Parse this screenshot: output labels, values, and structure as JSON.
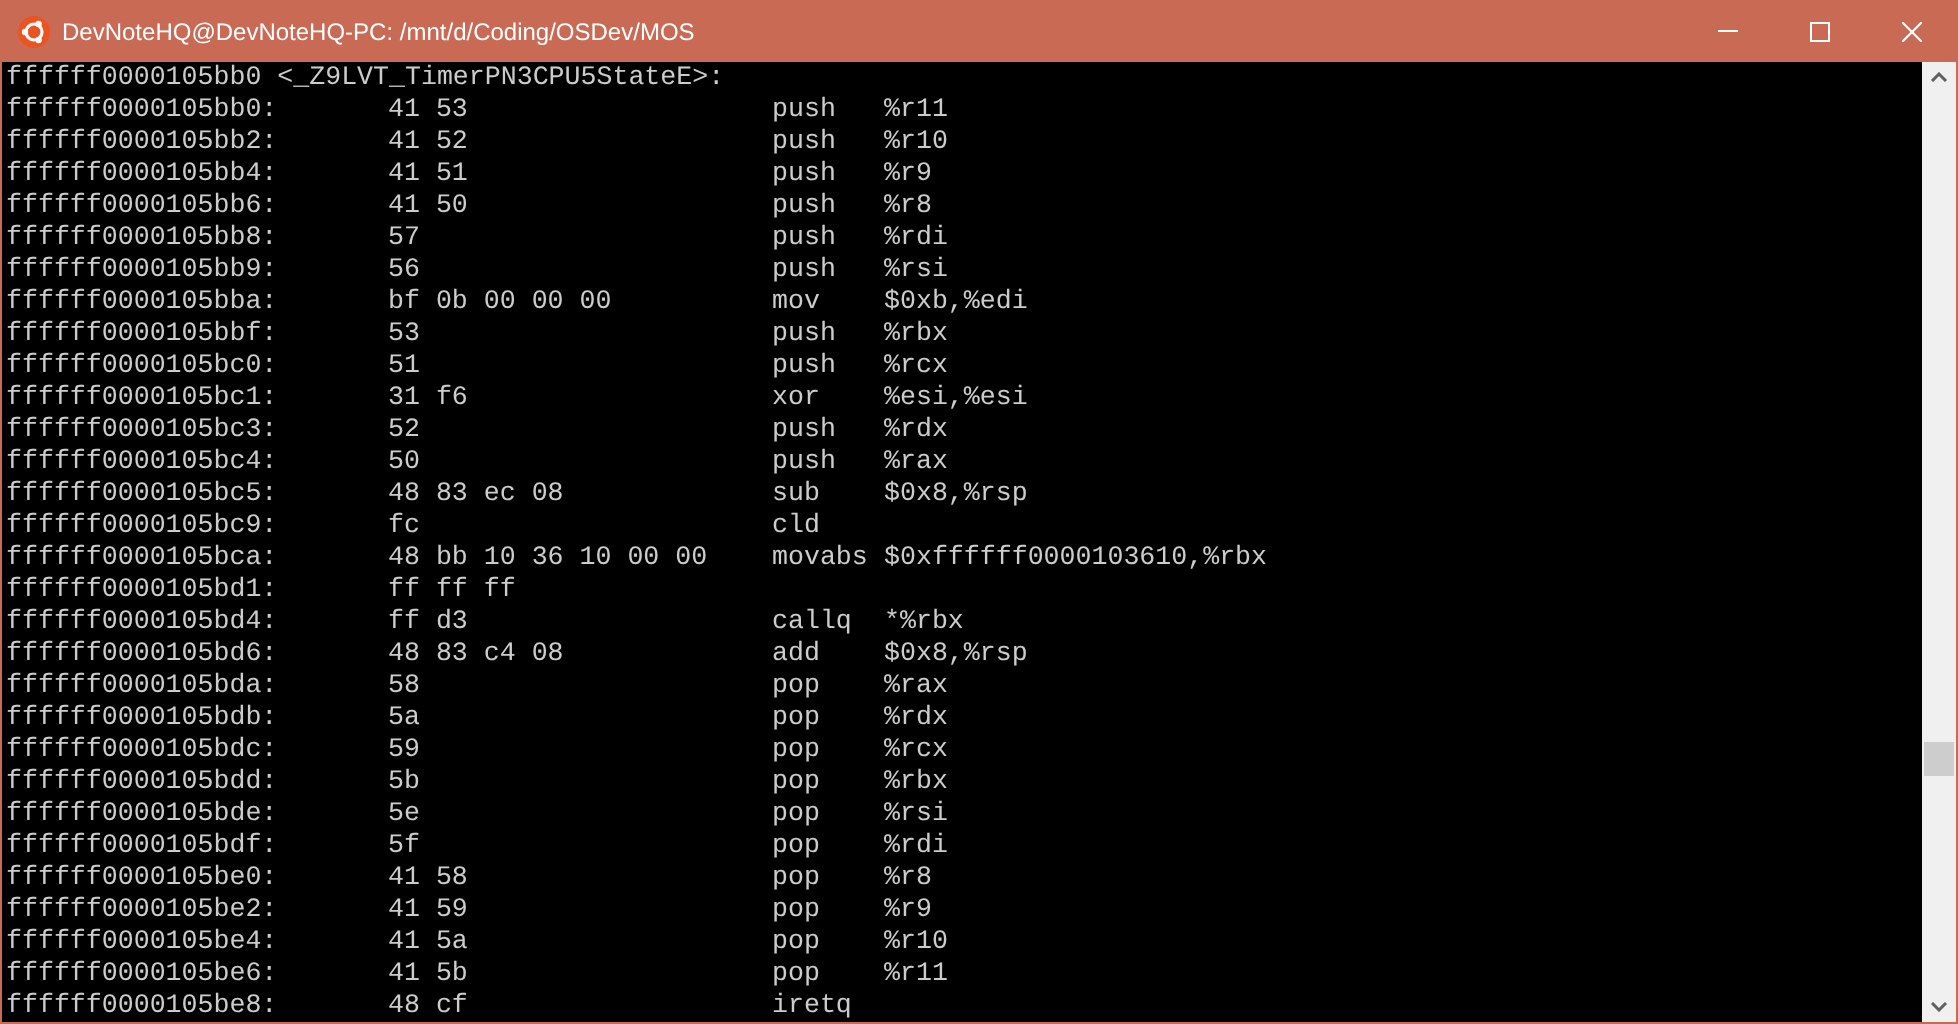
{
  "window": {
    "title": "DevNoteHQ@DevNoteHQ-PC: /mnt/d/Coding/OSDev/MOS"
  },
  "terminal": {
    "header": "ffffff0000105bb0 <_Z9LVT_TimerPN3CPU5StateE>:",
    "lines": [
      {
        "address": "ffffff0000105bb0:",
        "bytes": "41 53",
        "mnemonic": "push",
        "operands": "%r11"
      },
      {
        "address": "ffffff0000105bb2:",
        "bytes": "41 52",
        "mnemonic": "push",
        "operands": "%r10"
      },
      {
        "address": "ffffff0000105bb4:",
        "bytes": "41 51",
        "mnemonic": "push",
        "operands": "%r9"
      },
      {
        "address": "ffffff0000105bb6:",
        "bytes": "41 50",
        "mnemonic": "push",
        "operands": "%r8"
      },
      {
        "address": "ffffff0000105bb8:",
        "bytes": "57",
        "mnemonic": "push",
        "operands": "%rdi"
      },
      {
        "address": "ffffff0000105bb9:",
        "bytes": "56",
        "mnemonic": "push",
        "operands": "%rsi"
      },
      {
        "address": "ffffff0000105bba:",
        "bytes": "bf 0b 00 00 00",
        "mnemonic": "mov",
        "operands": "$0xb,%edi"
      },
      {
        "address": "ffffff0000105bbf:",
        "bytes": "53",
        "mnemonic": "push",
        "operands": "%rbx"
      },
      {
        "address": "ffffff0000105bc0:",
        "bytes": "51",
        "mnemonic": "push",
        "operands": "%rcx"
      },
      {
        "address": "ffffff0000105bc1:",
        "bytes": "31 f6",
        "mnemonic": "xor",
        "operands": "%esi,%esi"
      },
      {
        "address": "ffffff0000105bc3:",
        "bytes": "52",
        "mnemonic": "push",
        "operands": "%rdx"
      },
      {
        "address": "ffffff0000105bc4:",
        "bytes": "50",
        "mnemonic": "push",
        "operands": "%rax"
      },
      {
        "address": "ffffff0000105bc5:",
        "bytes": "48 83 ec 08",
        "mnemonic": "sub",
        "operands": "$0x8,%rsp"
      },
      {
        "address": "ffffff0000105bc9:",
        "bytes": "fc",
        "mnemonic": "cld"
      },
      {
        "address": "ffffff0000105bca:",
        "bytes": "48 bb 10 36 10 00 00",
        "mnemonic": "movabs",
        "operands": "$0xffffff0000103610,%rbx"
      },
      {
        "address": "ffffff0000105bd1:",
        "bytes": "ff ff ff"
      },
      {
        "address": "ffffff0000105bd4:",
        "bytes": "ff d3",
        "mnemonic": "callq",
        "operands": "*%rbx"
      },
      {
        "address": "ffffff0000105bd6:",
        "bytes": "48 83 c4 08",
        "mnemonic": "add",
        "operands": "$0x8,%rsp"
      },
      {
        "address": "ffffff0000105bda:",
        "bytes": "58",
        "mnemonic": "pop",
        "operands": "%rax"
      },
      {
        "address": "ffffff0000105bdb:",
        "bytes": "5a",
        "mnemonic": "pop",
        "operands": "%rdx"
      },
      {
        "address": "ffffff0000105bdc:",
        "bytes": "59",
        "mnemonic": "pop",
        "operands": "%rcx"
      },
      {
        "address": "ffffff0000105bdd:",
        "bytes": "5b",
        "mnemonic": "pop",
        "operands": "%rbx"
      },
      {
        "address": "ffffff0000105bde:",
        "bytes": "5e",
        "mnemonic": "pop",
        "operands": "%rsi"
      },
      {
        "address": "ffffff0000105bdf:",
        "bytes": "5f",
        "mnemonic": "pop",
        "operands": "%rdi"
      },
      {
        "address": "ffffff0000105be0:",
        "bytes": "41 58",
        "mnemonic": "pop",
        "operands": "%r8"
      },
      {
        "address": "ffffff0000105be2:",
        "bytes": "41 59",
        "mnemonic": "pop",
        "operands": "%r9"
      },
      {
        "address": "ffffff0000105be4:",
        "bytes": "41 5a",
        "mnemonic": "pop",
        "operands": "%r10"
      },
      {
        "address": "ffffff0000105be6:",
        "bytes": "41 5b",
        "mnemonic": "pop",
        "operands": "%r11"
      },
      {
        "address": "ffffff0000105be8:",
        "bytes": "48 cf",
        "mnemonic": "iretq"
      }
    ]
  }
}
